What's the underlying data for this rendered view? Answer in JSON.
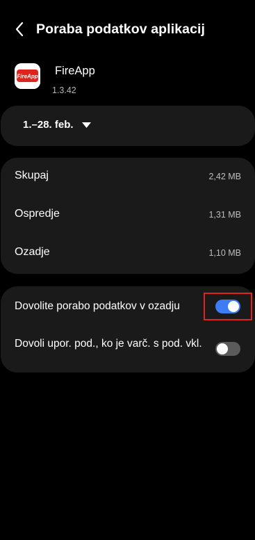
{
  "header": {
    "title": "Poraba podatkov aplikacij"
  },
  "app": {
    "name": "FireApp",
    "version": "1.3.42",
    "icon_text": "FireApp"
  },
  "date_range": {
    "label": "1.–28. feb."
  },
  "usage": {
    "rows": [
      {
        "label": "Skupaj",
        "value": "2,42 MB"
      },
      {
        "label": "Ospredje",
        "value": "1,31 MB"
      },
      {
        "label": "Ozadje",
        "value": "1,10 MB"
      }
    ]
  },
  "settings": {
    "background_data": {
      "label": "Dovolite porabo podatkov v ozadju",
      "enabled": true
    },
    "data_saver": {
      "label": "Dovoli upor. pod., ko je varč. s pod. vkl.",
      "enabled": false
    }
  },
  "colors": {
    "background": "#000000",
    "card": "#1a1a1a",
    "toggle_on": "#3d7cf4",
    "toggle_off": "#5b5b5b",
    "highlight": "#e52222",
    "app_icon_red": "#e0231c"
  }
}
